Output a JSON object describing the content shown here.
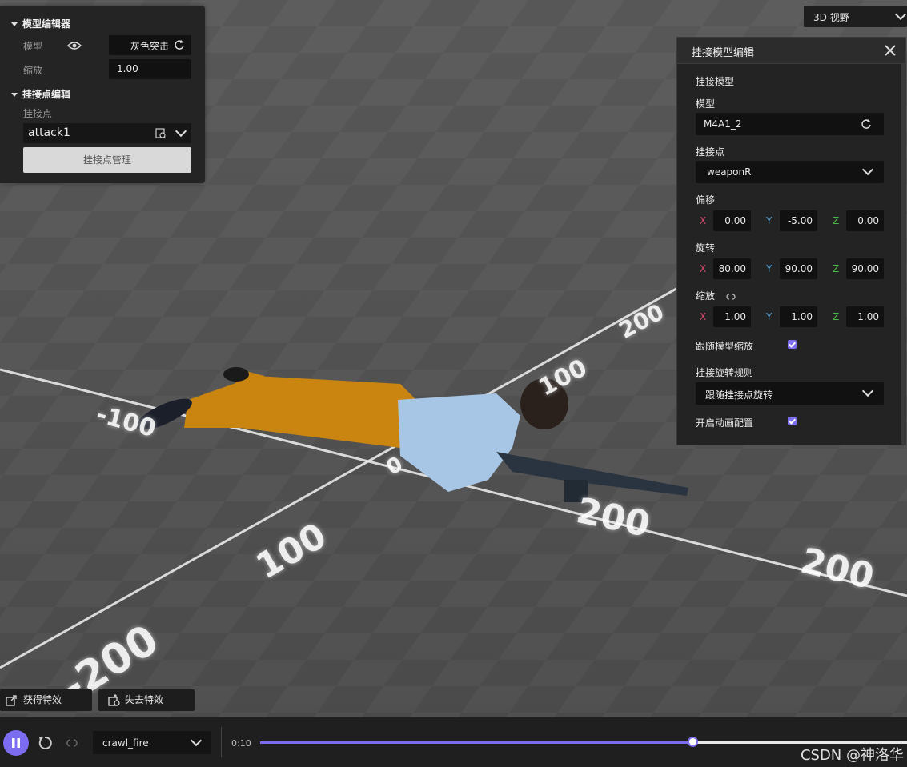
{
  "left_panel": {
    "model_editor_title": "模型编辑器",
    "model_label": "模型",
    "model_value": "灰色突击",
    "scale_label": "缩放",
    "scale_value": "1.00",
    "attach_editor_title": "挂接点编辑",
    "attach_point_label": "挂接点",
    "attach_point_value": "attack1",
    "manage_button": "挂接点管理"
  },
  "view_select": {
    "value": "3D 视野"
  },
  "attach_model_panel": {
    "title": "挂接模型编辑",
    "section_title": "挂接模型",
    "model_label": "模型",
    "model_value": "M4A1_2",
    "attach_point_label": "挂接点",
    "attach_point_value": "weaponR",
    "offset_label": "偏移",
    "offset": {
      "x": "0.00",
      "y": "-5.00",
      "z": "0.00"
    },
    "rotation_label": "旋转",
    "rotation": {
      "x": "80.00",
      "y": "90.00",
      "z": "90.00"
    },
    "scale_label": "缩放",
    "scale": {
      "x": "1.00",
      "y": "1.00",
      "z": "1.00"
    },
    "follow_scale_label": "跟随模型缩放",
    "follow_scale_checked": true,
    "rotation_rule_label": "挂接旋转规则",
    "rotation_rule_value": "跟随挂接点旋转",
    "anim_config_label": "开启动画配置",
    "anim_config_checked": true,
    "axis_x": "X",
    "axis_y": "Y",
    "axis_z": "Z"
  },
  "viewport": {
    "ground_labels": [
      "-100",
      "200",
      "100",
      "0",
      "100",
      "200",
      "200",
      "-200"
    ]
  },
  "effects": {
    "gain_label": "获得特效",
    "lose_label": "失去特效"
  },
  "playback": {
    "animation_value": "crawl_fire",
    "time": "0:10",
    "progress": 0.67
  },
  "watermark": "CSDN @神洛华",
  "colors": {
    "accent": "#7b6cf0",
    "axis_x": "#d04a6a",
    "axis_y": "#4a9fd8",
    "axis_z": "#4cb84c",
    "pants": "#d08a14",
    "shirt": "#a9c9e8"
  }
}
